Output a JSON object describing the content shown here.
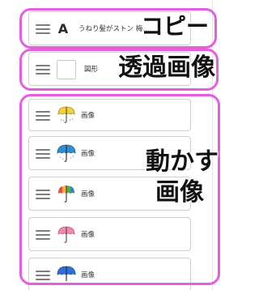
{
  "layers": [
    {
      "type": "text",
      "label": "うねり髪がストン 梅…",
      "thumb": "A"
    },
    {
      "type": "shape",
      "label": "図形"
    },
    {
      "type": "image",
      "label": "画像",
      "icon": "yellow-umbrella-icon"
    },
    {
      "type": "image",
      "label": "画像",
      "icon": "blue-umbrella-icon"
    },
    {
      "type": "image",
      "label": "画像",
      "icon": "rainbow-umbrella-icon"
    },
    {
      "type": "image",
      "label": "画像",
      "icon": "pink-umbrella-icon"
    },
    {
      "type": "image",
      "label": "画像",
      "icon": "blue-umbrella-icon"
    }
  ],
  "annotations": {
    "copy": "コピー",
    "transparent_image": "透過画像",
    "move_image_line1": "動かす",
    "move_image_line2": "画像"
  },
  "colors": {
    "highlight": "#e55ee0",
    "umbrella_yellow": "#f3d23a",
    "umbrella_blue": "#2f8fd0",
    "umbrella_pink": "#f08aa8"
  }
}
